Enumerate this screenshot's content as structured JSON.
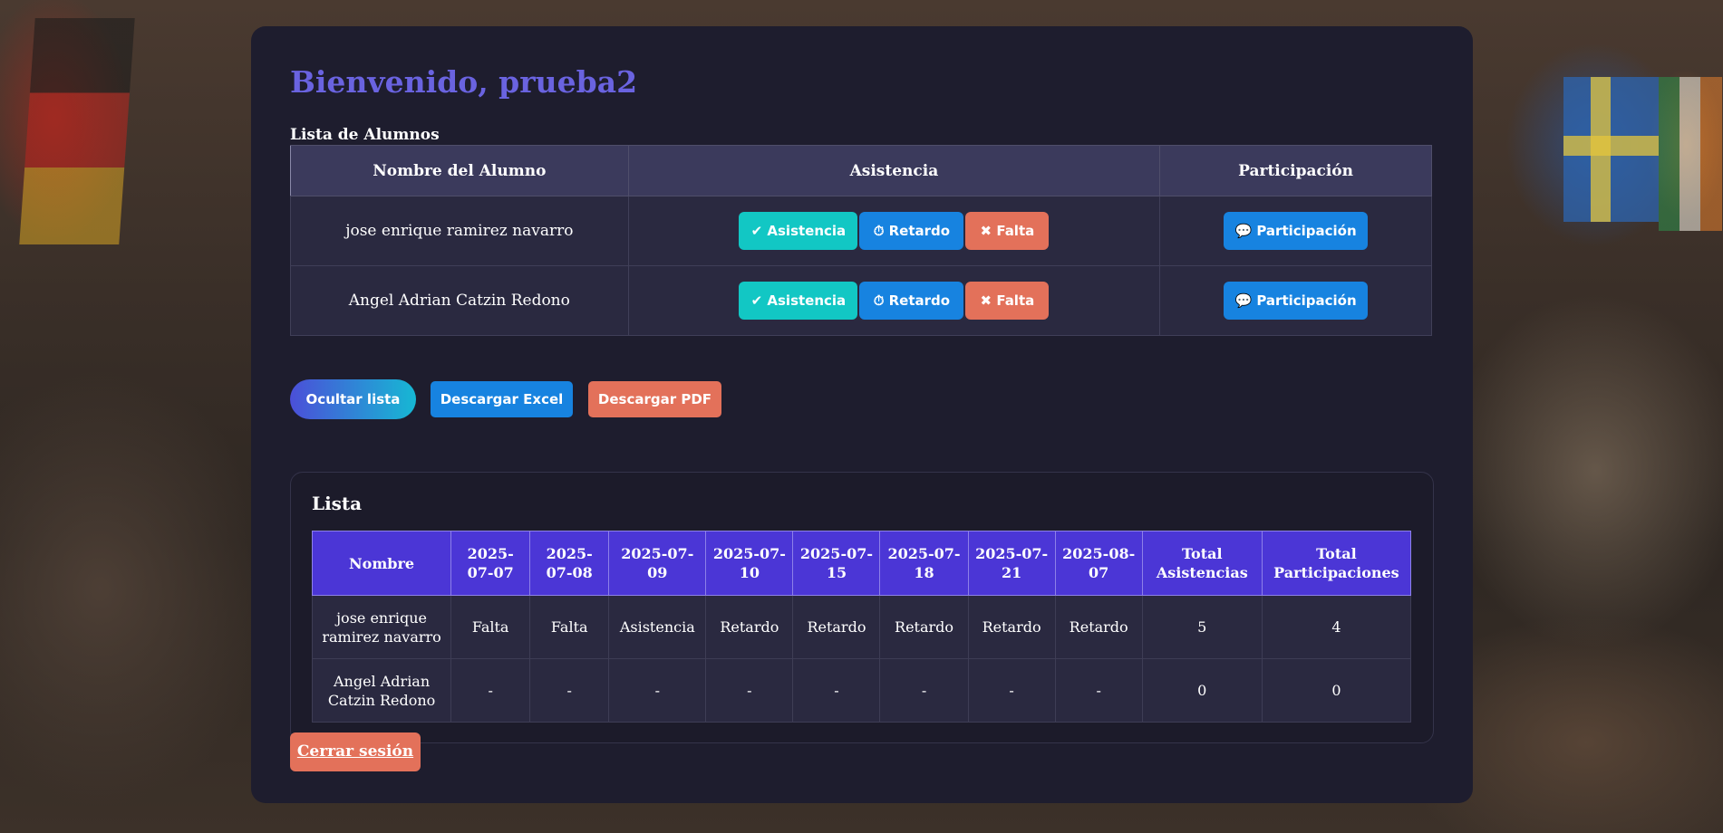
{
  "header": {
    "title": "Bienvenido, prueba2"
  },
  "students_section": {
    "label": "Lista de Alumnos",
    "columns": [
      "Nombre del Alumno",
      "Asistencia",
      "Participación"
    ],
    "rows": [
      {
        "name": "jose enrique ramirez navarro"
      },
      {
        "name": "Angel Adrian Catzin Redono"
      }
    ],
    "buttons": {
      "attendance": "✔ Asistencia",
      "late": "⏱ Retardo",
      "absent": "✖ Falta",
      "participation": "💬 Participación"
    }
  },
  "actions": {
    "hide_list": "Ocultar lista",
    "download_excel": "Descargar Excel",
    "download_pdf": "Descargar PDF"
  },
  "report": {
    "title": "Lista",
    "columns": [
      "Nombre",
      "2025-07-07",
      "2025-07-08",
      "2025-07-09",
      "2025-07-10",
      "2025-07-15",
      "2025-07-18",
      "2025-07-21",
      "2025-08-07",
      "Total Asistencias",
      "Total Participaciones"
    ],
    "rows": [
      [
        "jose enrique ramirez navarro",
        "Falta",
        "Falta",
        "Asistencia",
        "Retardo",
        "Retardo",
        "Retardo",
        "Retardo",
        "Retardo",
        "5",
        "4"
      ],
      [
        "Angel Adrian Catzin Redono",
        "-",
        "-",
        "-",
        "-",
        "-",
        "-",
        "-",
        "-",
        "0",
        "0"
      ]
    ]
  },
  "logout": {
    "label": "Cerrar sesión"
  },
  "colors": {
    "title": "#6a63e0",
    "attendance": "#12c7c4",
    "late": "#1783e0",
    "absent": "#e3715a",
    "report_header": "#4b36d6"
  }
}
